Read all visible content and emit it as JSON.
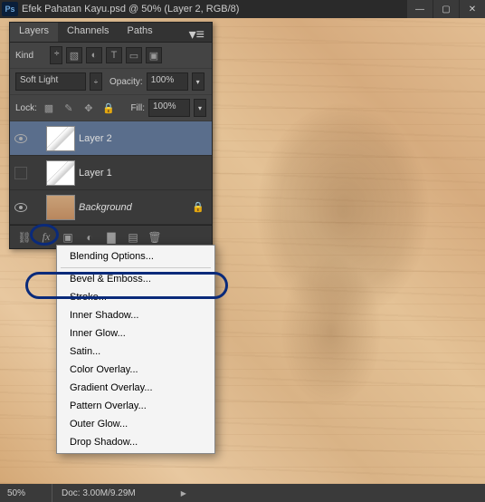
{
  "titlebar": {
    "badge": "Ps",
    "title": "Efek Pahatan Kayu.psd @ 50% (Layer 2, RGB/8)",
    "min": "—",
    "max": "▢",
    "close": "✕"
  },
  "panel": {
    "tabs": {
      "layers": "Layers",
      "channels": "Channels",
      "paths": "Paths"
    },
    "menuIcon": "▾≡",
    "kindLabel": "Kind",
    "kindArrow": "÷",
    "filterIcons": {
      "pixel": "▧",
      "adjust": "◐",
      "type": "T",
      "shape": "▭",
      "smart": "▣"
    },
    "blendMode": "Soft Light",
    "blendArrow": "÷",
    "opacityLabel": "Opacity:",
    "opacityValue": "100%",
    "lockLabel": "Lock:",
    "lockIcons": {
      "trans": "▩",
      "paint": "✎",
      "move": "✥",
      "all": "🔒"
    },
    "fillLabel": "Fill:",
    "fillValue": "100%",
    "layers": [
      {
        "name": "Layer 2"
      },
      {
        "name": "Layer 1"
      },
      {
        "name": "Background"
      }
    ],
    "lockGlyph": "🔒",
    "footer": {
      "link": "⛓",
      "fx": "fx",
      "mask": "▣",
      "fill": "◐",
      "group": "▇",
      "new": "▤",
      "trash": "🗑"
    }
  },
  "fxMenu": {
    "blendingOptions": "Blending Options...",
    "bevel": "Bevel & Emboss...",
    "stroke": "Stroke...",
    "innerShadow": "Inner Shadow...",
    "innerGlow": "Inner Glow...",
    "satin": "Satin...",
    "colorOverlay": "Color Overlay...",
    "gradientOverlay": "Gradient Overlay...",
    "patternOverlay": "Pattern Overlay...",
    "outerGlow": "Outer Glow...",
    "dropShadow": "Drop Shadow..."
  },
  "status": {
    "zoom": "50%",
    "doc": "Doc: 3.00M/9.29M",
    "arrow": "▶"
  }
}
